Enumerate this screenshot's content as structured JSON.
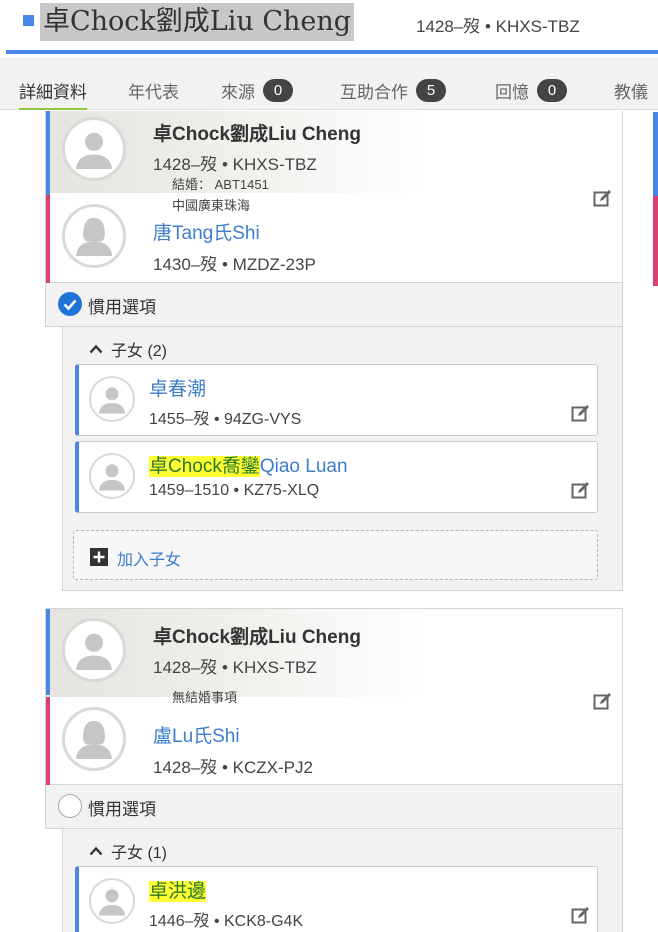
{
  "header": {
    "title": "卓Chock劉成Liu Cheng",
    "meta": "1428–歿 • KHXS-TBZ",
    "accent": "#4a86e8"
  },
  "tabs": [
    {
      "label": "詳細資料",
      "badge": null
    },
    {
      "label": "年代表",
      "badge": null
    },
    {
      "label": "來源",
      "badge": "0"
    },
    {
      "label": "互助合作",
      "badge": "5"
    },
    {
      "label": "回憶",
      "badge": "0"
    },
    {
      "label": "教儀",
      "badge": null
    }
  ],
  "families": [
    {
      "husband": {
        "name": "卓Chock劉成Liu Cheng",
        "meta": "1428–歿 •  KHXS-TBZ",
        "icon": "male-avatar-icon"
      },
      "marriage": {
        "line1": "結婚： ABT1451",
        "line2": "中國廣東珠海"
      },
      "wife": {
        "name": "唐Tang氏Shi",
        "meta": "1430–歿 •  MZDZ-23P",
        "icon": "female-avatar-icon"
      },
      "preferred": true,
      "preferred_label": "慣用選項",
      "children_label": "子女 (2)",
      "children": [
        {
          "name_hl": "",
          "name": "卓春潮",
          "meta": "1455–歿 •  94ZG-VYS"
        },
        {
          "name_hl": "卓Chock喬鑾",
          "name": "Qiao Luan",
          "meta": "1459–1510 •  KZ75-XLQ"
        }
      ],
      "add_child_label": "加入子女"
    },
    {
      "husband": {
        "name": "卓Chock劉成Liu Cheng",
        "meta": "1428–歿 •  KHXS-TBZ",
        "icon": "male-avatar-icon"
      },
      "marriage": {
        "line1": "無結婚事項",
        "line2": ""
      },
      "wife": {
        "name": "盧Lu氏Shi",
        "meta": "1428–歿 •  KCZX-PJ2",
        "icon": "female-avatar-icon"
      },
      "preferred": false,
      "preferred_label": "慣用選項",
      "children_label": "子女 (1)",
      "children": [
        {
          "name_hl": "卓洪邊",
          "name": "",
          "meta": "1446–歿 •  KCK8-G4K"
        }
      ]
    }
  ],
  "colors": {
    "male": "#4a86e8",
    "female": "#d9426e",
    "link": "#3d7dcb",
    "highlight": "#ffff33",
    "active_tab": "#8dc63f"
  }
}
